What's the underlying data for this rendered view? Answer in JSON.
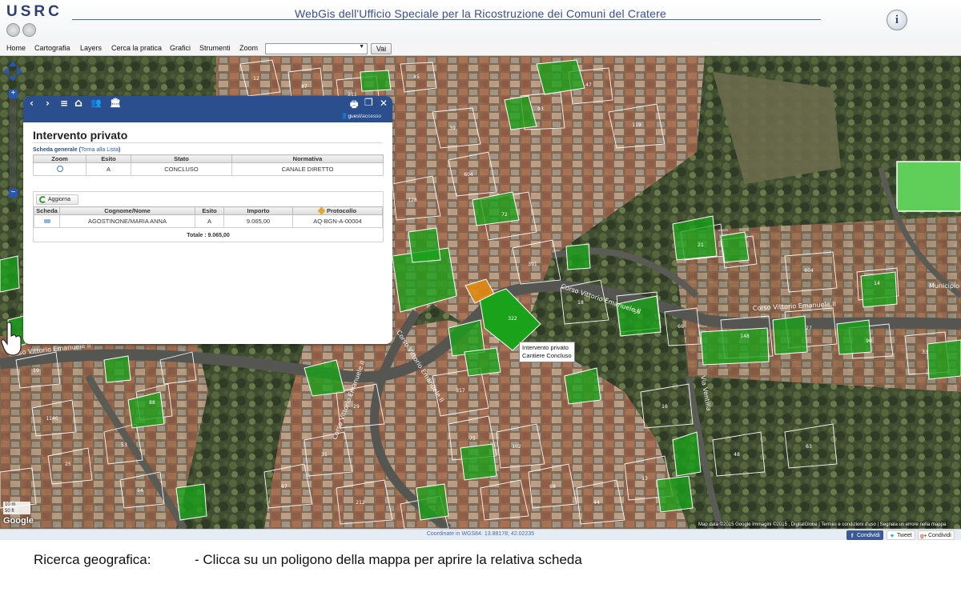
{
  "header": {
    "logo": "USRC",
    "title": "WebGis dell'Ufficio Speciale per la Ricostruzione dei Comuni del Cratere",
    "info_icon": "info-icon"
  },
  "menu": {
    "items": [
      "Home",
      "Cartografia",
      "Layers",
      "Cerca la pratica",
      "Grafici",
      "Strumenti",
      "Zoom"
    ],
    "select_value": "",
    "go_label": "Vai"
  },
  "map": {
    "street_labels": [
      "Corso Vittorio Emanuele II",
      "Corso Vittorio Emanuele II",
      "Corso Vittorio Emanuele II",
      "Corso Vittorio Emanuele II",
      "Via Ventilla",
      "Corso Vittorio Emanuele II",
      "Municipio d"
    ],
    "scale_top": "10 m",
    "scale_bottom": "50 ft",
    "google": "Google",
    "attribution": "Map data ©2015 Google Immagini ©2015 , DigitalGlobe  |  Termini e condizioni d'uso  |  Segnala un errore nella mappa",
    "tooltip_line1": "Intervento privato",
    "tooltip_line2": "Cantiere Concluso",
    "colors": {
      "concluso": "#1aa31a",
      "in_corso": "#e08a12",
      "parcel_line": "#ffffff"
    }
  },
  "panel": {
    "toolbar_icons": [
      "back-icon",
      "forward-icon",
      "menu-icon",
      "home-icon",
      "people-icon",
      "building-icon",
      "print-icon",
      "maximize-icon",
      "close-icon"
    ],
    "user": "guest",
    "user_suffix": "/accesso",
    "title": "Intervento privato",
    "scheda_label": "Scheda generale (",
    "scheda_link": "Torna alla Lista",
    "scheda_close": ")",
    "table1": {
      "headers": [
        "Zoom",
        "Esito",
        "Stato",
        "Normativa"
      ],
      "row": {
        "esito": "A",
        "stato": "CONCLUSO",
        "normativa": "CANALE DIRETTO"
      }
    },
    "refresh_label": "Aggiorna",
    "table2": {
      "headers": [
        "Scheda",
        "Cognome/Nome",
        "Esito",
        "Importo",
        "Protocollo"
      ],
      "row": {
        "nome": "AGOSTINONE/MARIA ANNA",
        "esito": "A",
        "importo": "9.065,00",
        "protocollo": "AQ-BGN-A-00004"
      },
      "total": "Totale : 9.065,00"
    }
  },
  "statusbar": {
    "coords": "Coordinate in WGS84: 13.88178; 42.02235",
    "facebook": "Condividi",
    "twitter": "Tweet",
    "gplus": "Condividi"
  },
  "caption": {
    "left": "Ricerca geografica:",
    "right": "- Clicca su un poligono della mappa per aprire la relativa scheda"
  }
}
